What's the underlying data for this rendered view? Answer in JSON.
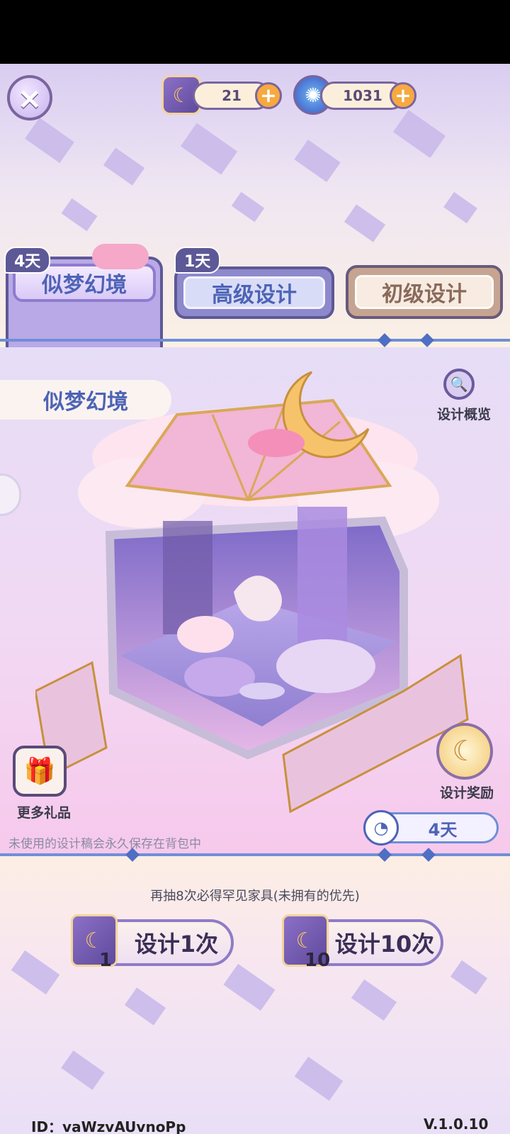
{
  "header": {
    "close_icon": "×",
    "currency_scroll": {
      "icon": "scroll-icon",
      "value": "21"
    },
    "currency_gem": {
      "icon": "swirl-gem-icon",
      "value": "1031"
    },
    "plus": "+"
  },
  "tabs": [
    {
      "label": "似梦幻境",
      "badge": "4天",
      "active": true
    },
    {
      "label": "高级设计",
      "badge": "1天",
      "active": false
    },
    {
      "label": "初级设计",
      "badge": "",
      "active": false
    }
  ],
  "banner": {
    "title": "似梦幻境"
  },
  "side": {
    "overview_label": "设计概览",
    "overview_icon": "🔍",
    "gifts_label": "更多礼品",
    "gifts_icon": "🎁",
    "rewards_label": "设计奖励",
    "rewards_icon": "☾"
  },
  "timer": {
    "value": "4天",
    "icon": "◔"
  },
  "notice": "未使用的设计稿会永久保存在背包中",
  "hint": "再抽8次必得罕见家具(未拥有的优先)",
  "actions": [
    {
      "label": "设计1次",
      "count": "1"
    },
    {
      "label": "设计10次",
      "count": "10"
    }
  ],
  "footer": {
    "id": "ID：vaWzvAUvnoPp",
    "version": "V.1.0.10"
  },
  "colors": {
    "accent": "#6f8ed8",
    "tab_active": "#b9a9e6",
    "tab_advanced": "#8d89cc",
    "tab_basic": "#c5a492"
  }
}
